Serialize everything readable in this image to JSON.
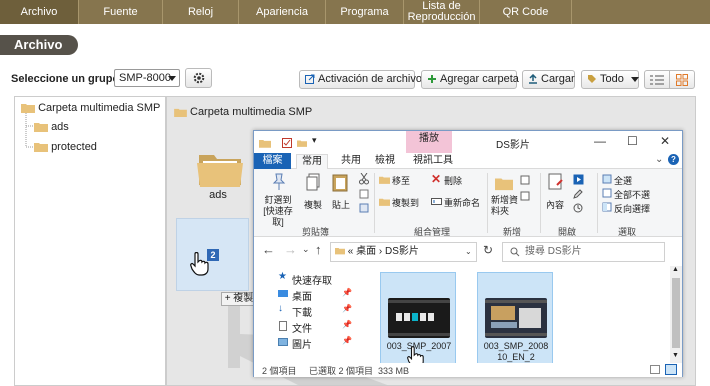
{
  "topnav": {
    "tabs": [
      "Archivo",
      "Fuente",
      "Reloj",
      "Apariencia",
      "Programa",
      "Lista de Reproducción",
      "QR Code"
    ],
    "active": "Archivo"
  },
  "page": {
    "title": "Archivo"
  },
  "toolbar": {
    "group_label": "Seleccione un grupo:",
    "group_value": "SMP-8000",
    "btn_activation": "Activación de archivo",
    "btn_add_folder": "Agregar carpeta",
    "btn_upload": "Cargar",
    "btn_filter": "Todo"
  },
  "tree": {
    "root": "Carpeta multimedia SMP",
    "children": [
      "ads",
      "protected"
    ]
  },
  "main": {
    "path": "Carpeta multimedia SMP",
    "folder_name": "ads",
    "drag_count": "2",
    "copy_tip": "+ 複製"
  },
  "explorer": {
    "context_tab": "播放",
    "title": "DS影片",
    "ribbon_tabs": [
      "檔案",
      "常用",
      "共用",
      "檢視",
      "視訊工具"
    ],
    "groups": {
      "clipboard": "剪貼簿",
      "organize": "組合管理",
      "new": "新增",
      "open": "開啟",
      "select": "選取"
    },
    "buttons": {
      "pin": "釘選到 [快速存取]",
      "copy": "複製",
      "paste": "貼上",
      "move_to": "移至",
      "copy_to": "複製到",
      "delete": "刪除",
      "rename": "重新命名",
      "new_folder": "新增資料夾",
      "properties": "內容",
      "select_all": "全選",
      "select_none": "全部不選",
      "invert_select": "反向選擇"
    },
    "address": "« 桌面 › DS影片",
    "search_placeholder": "搜尋 DS影片",
    "nav": [
      "快速存取",
      "桌面",
      "下載",
      "文件",
      "圖片"
    ],
    "files": [
      {
        "name": "003_SMP_2007"
      },
      {
        "name": "003_SMP_2008 10_EN_2"
      }
    ],
    "status": "2 個項目     已選取 2 個項目  333 MB"
  },
  "colors": {
    "topnav_bg": "#86754e",
    "accent_blue": "#1a63b5",
    "selection_bg": "#cce4f7"
  }
}
